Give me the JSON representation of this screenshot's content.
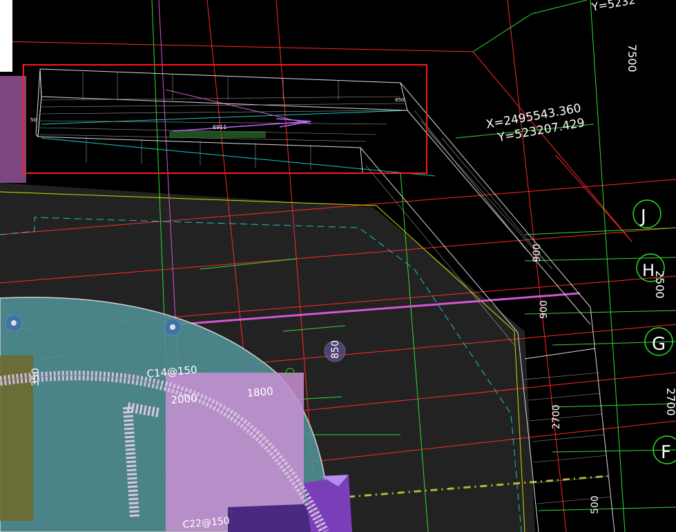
{
  "coords_far": {
    "x": "X=2495543.360",
    "y": "Y=523207.429"
  },
  "coord_top_partial": "Y=5232",
  "axes": [
    {
      "letter": "J"
    },
    {
      "letter": "H"
    },
    {
      "letter": "G"
    },
    {
      "letter": "F"
    }
  ],
  "dims": {
    "d7500": "7500",
    "d2500": "2500",
    "d2700_right": "2700",
    "d2700_wall": "2700",
    "d900_a": "900",
    "d900_b": "900",
    "d500": "500",
    "d850": "850",
    "d350": "350",
    "d2000": "2000",
    "d1800": "1800",
    "d6911": "6911",
    "d50": "50",
    "d850_small": "850"
  },
  "rebar": {
    "r1": "C14@150",
    "r2": "C22@150"
  },
  "colors": {
    "cad_red": "#ff2a2a",
    "cad_green": "#2de02d",
    "cad_cyan": "#19c7c7",
    "cad_magenta": "#d457d4",
    "cad_yellow": "#d9d900",
    "slab_teal": "#4f8f94",
    "slab_pink": "#c98fd4",
    "selection_red": "#ff1a1a"
  }
}
